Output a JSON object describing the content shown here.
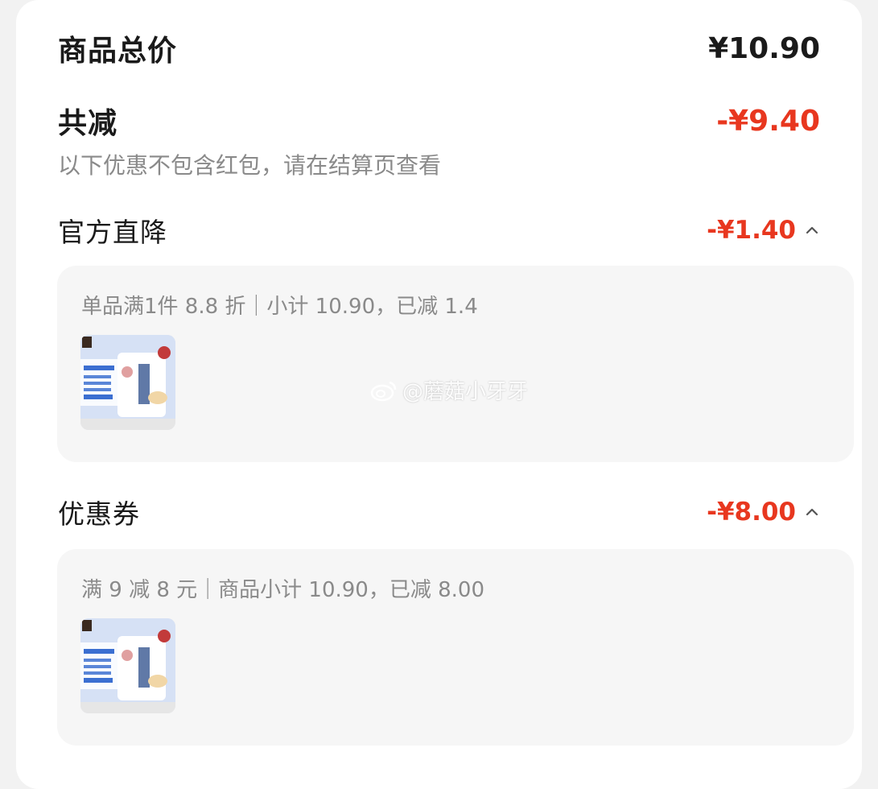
{
  "summary": {
    "total_label": "商品总价",
    "total_amount": "¥10.90",
    "discount_label": "共减",
    "discount_amount": "-¥9.40",
    "note": "以下优惠不包含红包，请在结算页查看"
  },
  "sections": [
    {
      "title": "官方直降",
      "amount": "-¥1.40",
      "detail": "单品满1件 8.8 折｜小计 10.90，已减 1.4",
      "thumb_label": "product-thumbnail"
    },
    {
      "title": "优惠券",
      "amount": "-¥8.00",
      "detail": "满 9 减 8 元｜商品小计 10.90，已减 8.00",
      "thumb_label": "product-thumbnail"
    }
  ],
  "watermark": "@蘑菇小牙牙",
  "colors": {
    "accent_red": "#e8371f",
    "panel_bg": "#f6f6f6"
  }
}
